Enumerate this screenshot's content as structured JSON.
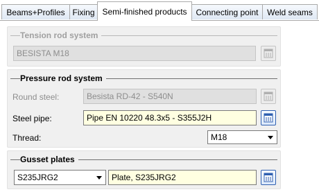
{
  "tabs": [
    {
      "label": "Beams+Profiles",
      "active": false
    },
    {
      "label": "Fixing",
      "active": false
    },
    {
      "label": "Semi-finished products",
      "active": true
    },
    {
      "label": "Connecting point",
      "active": false
    },
    {
      "label": "Weld seams",
      "active": false
    }
  ],
  "tension_rod": {
    "title": "Tension rod system",
    "enabled": false,
    "value": "BESISTA M18",
    "library_icon": "library-icon"
  },
  "pressure_rod": {
    "title": "Pressure rod system",
    "round_steel": {
      "label": "Round steel:",
      "value": "Besista RD-42 - S540N",
      "enabled": false
    },
    "steel_pipe": {
      "label": "Steel pipe:",
      "value": "Pipe EN 10220 48.3x5 - S355J2H",
      "enabled": true
    },
    "thread": {
      "label": "Thread:",
      "value": "M18"
    }
  },
  "gusset_plates": {
    "title": "Gusset plates",
    "material": "S235JRG2",
    "plate": "Plate, S235JRG2"
  },
  "colors": {
    "field_bg": "#ffffe1",
    "disabled_bg": "#e0e0e0",
    "group_bg": "#f0f0f0",
    "accent": "#2f5fb0"
  }
}
